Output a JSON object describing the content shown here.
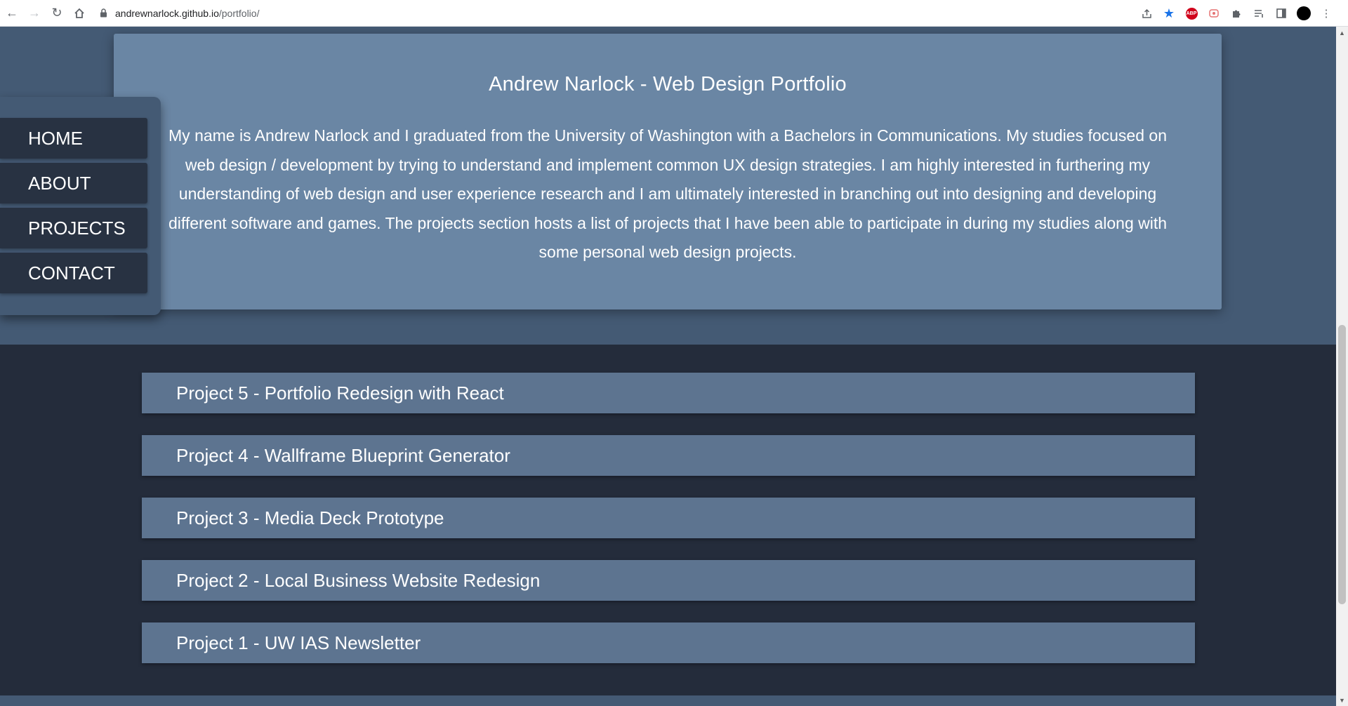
{
  "browser": {
    "url_host": "andrewnarlock.github.io",
    "url_path": "/portfolio/",
    "extension_abp_label": "ABP"
  },
  "nav": {
    "items": [
      {
        "label": "HOME"
      },
      {
        "label": "ABOUT"
      },
      {
        "label": "PROJECTS"
      },
      {
        "label": "CONTACT"
      }
    ]
  },
  "hero": {
    "title": "Andrew Narlock - Web Design Portfolio",
    "paragraph": "My name is Andrew Narlock and I graduated from the University of Washington with a Bachelors in Communications. My studies focused on web design / development by trying to understand and implement common UX design strategies. I am highly interested in furthering my understanding of web design and user experience research and I am ultimately interested in branching out into designing and developing different software and games. The projects section hosts a list of projects that I have been able to participate in during my studies along with some personal web design projects."
  },
  "projects": [
    {
      "label": "Project 5 - Portfolio Redesign with React"
    },
    {
      "label": "Project 4 - Wallframe Blueprint Generator"
    },
    {
      "label": "Project 3 - Media Deck Prototype"
    },
    {
      "label": "Project 2 - Local Business Website Redesign"
    },
    {
      "label": "Project 1 - UW IAS Newsletter"
    }
  ],
  "colors": {
    "page_bg": "#445a74",
    "hero_bg": "#6a86a4",
    "nav_item_bg": "#283242",
    "projects_section_bg": "#242c3b",
    "project_item_bg": "#5d7490"
  }
}
